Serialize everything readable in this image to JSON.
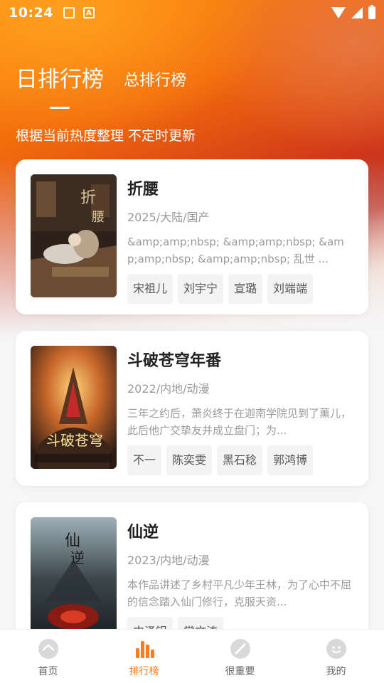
{
  "status_bar": {
    "time": "10:24",
    "badge_letter": "A"
  },
  "tabs": {
    "active": "日排行榜",
    "other": "总排行榜"
  },
  "subtitle": "根据当前热度整理 不定时更新",
  "items": [
    {
      "title": "折腰",
      "meta": "2025/大陆/国产",
      "desc": "&amp;amp;nbsp; &amp;amp;nbsp; &amp;amp;nbsp; &amp;amp;nbsp; 乱世 ...",
      "tags": [
        "宋祖儿",
        "刘宇宁",
        "宣璐",
        "刘端端"
      ],
      "poster_colors": [
        "#3a2a20",
        "#7a5a3a",
        "#c9a878"
      ]
    },
    {
      "title": "斗破苍穹年番",
      "meta": "2022/内地/动漫",
      "desc": "三年之约后，萧炎终于在迦南学院见到了薰儿，此后他广交挚友并成立盘门；为...",
      "tags": [
        "不一",
        "陈奕雯",
        "黑石稔",
        "郭鸿博"
      ],
      "poster_colors": [
        "#3a2418",
        "#b8622a",
        "#f2b24a"
      ]
    },
    {
      "title": "仙逆",
      "meta": "2023/内地/动漫",
      "desc": "本作品讲述了乡村平凡少年王林，为了心中不屈的信念踏入仙门修行，克服天资...",
      "tags": [
        "中泽铝",
        "常文涛"
      ],
      "poster_colors": [
        "#1f2a30",
        "#4d5a60",
        "#9a2a20"
      ]
    }
  ],
  "tabbar": {
    "items": [
      {
        "label": "首页",
        "icon": "home-icon"
      },
      {
        "label": "排行榜",
        "icon": "ranking-icon"
      },
      {
        "label": "很重要",
        "icon": "bookmark-icon"
      },
      {
        "label": "我的",
        "icon": "profile-icon"
      }
    ],
    "active_color": "#ff7a1a"
  }
}
